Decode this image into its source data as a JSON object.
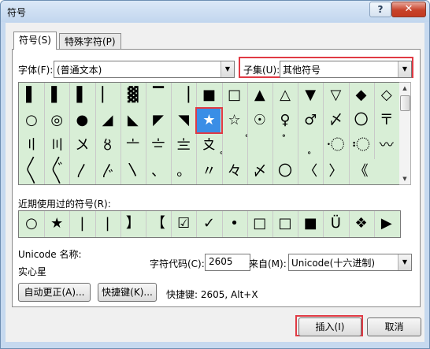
{
  "window": {
    "title": "符号",
    "help_label": "?",
    "close_label": "✕"
  },
  "tabs": [
    {
      "label": "符号(S)"
    },
    {
      "label": "特殊字符(P)"
    }
  ],
  "font": {
    "label": "字体(F):",
    "value": "(普通文本)"
  },
  "subset": {
    "label": "子集(U):",
    "value": "其他符号"
  },
  "symbols": [
    [
      "▌",
      "▌",
      "▌",
      "▏",
      "▓",
      "▔",
      "▕",
      "■",
      "□",
      "▲",
      "△",
      "▼",
      "▽",
      "◆",
      "◇"
    ],
    [
      "○",
      "◎",
      "●",
      "◢",
      "◣",
      "◤",
      "◥",
      "★",
      "☆",
      "☉",
      "♀",
      "♂",
      "〆",
      "〇",
      "〒"
    ],
    [
      "〢",
      "〣",
      "〤",
      "〥",
      "〦",
      "〧",
      "〨",
      "〩",
      "〪",
      "〫",
      "〬",
      "〭",
      "〮",
      "〯",
      "〰"
    ],
    [
      "〱",
      "〲",
      "〳",
      "〴",
      "〵",
      "、",
      "。",
      "〃",
      "々",
      "〆",
      "〇",
      "〈",
      "〉",
      "《"
    ]
  ],
  "recent": {
    "label": "近期使用过的符号(R):",
    "items": [
      "○",
      "★",
      "|",
      "|",
      "】",
      "【",
      "☑",
      "✓",
      "•",
      "□",
      "□",
      "■",
      "Ü",
      "❖",
      "▶"
    ]
  },
  "unicode": {
    "name_label": "Unicode 名称:",
    "name_value": "实心星",
    "code_label": "字符代码(C):",
    "code_value": "2605",
    "from_label": "来自(M):",
    "from_value": "Unicode(十六进制)"
  },
  "buttons": {
    "autocorrect": "自动更正(A)...",
    "shortcut_key": "快捷键(K)...",
    "shortcut_info": "快捷键: 2605, Alt+X",
    "insert": "插入(I)",
    "cancel": "取消"
  },
  "colors": {
    "grid_bg": "#d8eed6",
    "selection": "#3a8ee6",
    "highlight": "#e03a44"
  }
}
